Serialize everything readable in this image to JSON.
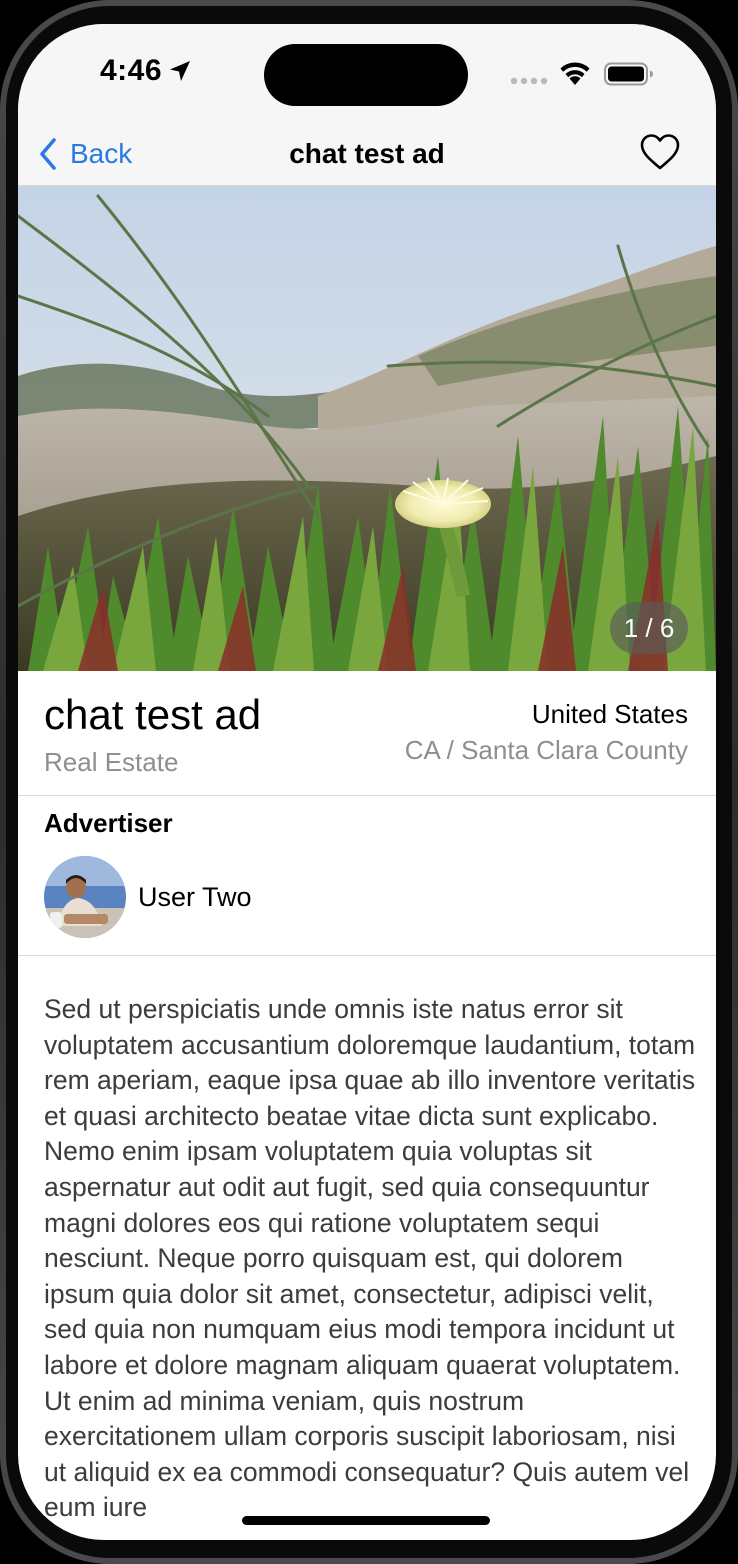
{
  "status_bar": {
    "time": "4:46",
    "icons": [
      "location-arrow-icon",
      "cellular-signal-icon",
      "wifi-icon",
      "battery-icon"
    ]
  },
  "nav": {
    "back_label": "Back",
    "title": "chat test ad",
    "favorite_icon": "heart-outline-icon",
    "accent_color": "#2a7ae2"
  },
  "gallery": {
    "counter": "1 / 6",
    "current": 1,
    "total": 6
  },
  "ad": {
    "title": "chat test ad",
    "category": "Real Estate",
    "country": "United States",
    "region": "CA / Santa Clara County"
  },
  "advertiser": {
    "heading": "Advertiser",
    "name": "User Two"
  },
  "description": "Sed ut perspiciatis unde omnis iste natus error sit voluptatem accusantium doloremque laudantium, totam rem aperiam, eaque ipsa quae ab illo inventore veritatis et quasi architecto beatae vitae dicta sunt explicabo. Nemo enim ipsam voluptatem quia voluptas sit aspernatur aut odit aut fugit, sed quia consequuntur magni dolores eos qui ratione voluptatem sequi nesciunt. Neque porro quisquam est, qui dolorem ipsum quia dolor sit amet, consectetur, adipisci velit, sed quia non numquam eius modi tempora incidunt ut labore et dolore magnam aliquam quaerat voluptatem. Ut enim ad minima veniam, quis nostrum exercitationem ullam corporis suscipit laboriosam, nisi ut aliquid ex ea commodi consequatur? Quis autem vel eum iure"
}
